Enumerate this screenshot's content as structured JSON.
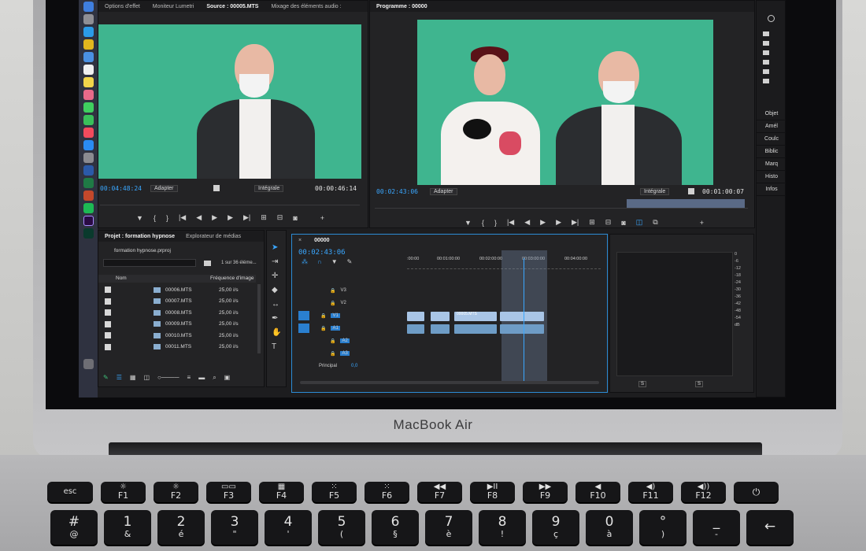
{
  "device": {
    "brand": "MacBook Air"
  },
  "source_monitor": {
    "tabs": [
      "Options d'effet",
      "Moniteur Lumetri",
      "Source : 00005.MTS",
      "Mixage des éléments audio :"
    ],
    "active_tab_index": 2,
    "timecode_in": "00:04:48:24",
    "fit": "Adapter",
    "quality": "Intégrale",
    "timecode_out": "00:00:46:14"
  },
  "program_monitor": {
    "tab": "Programme : 00000",
    "timecode_in": "00:02:43:06",
    "fit": "Adapter",
    "quality": "Intégrale",
    "timecode_out": "00:01:00:07"
  },
  "project_panel": {
    "tabs": [
      "Projet : formation hypnose",
      "Explorateur de médias"
    ],
    "project_file": "formation hypnose.prproj",
    "item_count": "1 sur 36 éléme...",
    "columns": [
      "Nom",
      "Fréquence d'image"
    ],
    "rows": [
      {
        "name": "00006.MTS",
        "fps": "25,00 i/s"
      },
      {
        "name": "00007.MTS",
        "fps": "25,00 i/s"
      },
      {
        "name": "00008.MTS",
        "fps": "25,00 i/s"
      },
      {
        "name": "00009.MTS",
        "fps": "25,00 i/s"
      },
      {
        "name": "00010.MTS",
        "fps": "25,00 i/s"
      },
      {
        "name": "00011.MTS",
        "fps": "25,00 i/s"
      }
    ]
  },
  "timeline": {
    "sequence": "00000",
    "timecode": "00:02:43:06",
    "ruler": [
      ":00:00",
      "00:01:00:00",
      "00:02:00:00",
      "00:03:00:00",
      "00:04:00:00"
    ],
    "video_tracks": [
      "V3",
      "V2",
      "V1"
    ],
    "audio_tracks": [
      "A1",
      "A2",
      "A3"
    ],
    "master_label": "Principal",
    "master_value": "0,0",
    "clip_label": "00005.MTS"
  },
  "audio_meter": {
    "scale": [
      "0",
      "-6",
      "-12",
      "-18",
      "-24",
      "-30",
      "-36",
      "-42",
      "-48",
      "-54",
      "dB"
    ],
    "channels": [
      "S",
      "S"
    ]
  },
  "side_panel": {
    "buttons": [
      "Objet",
      "Amél",
      "Coulc",
      "Biblic",
      "Marq",
      "Histo",
      "Infos"
    ]
  },
  "keyboard": {
    "fn_row": [
      {
        "main": "esc",
        "sub": ""
      },
      {
        "main": "☼",
        "sub": "F1"
      },
      {
        "main": "☼",
        "sub": "F2"
      },
      {
        "main": "▭▭",
        "sub": "F3"
      },
      {
        "main": "▦",
        "sub": "F4"
      },
      {
        "main": "⁙",
        "sub": "F5"
      },
      {
        "main": "⁙",
        "sub": "F6"
      },
      {
        "main": "◀◀",
        "sub": "F7"
      },
      {
        "main": "▶II",
        "sub": "F8"
      },
      {
        "main": "▶▶",
        "sub": "F9"
      },
      {
        "main": "◀",
        "sub": "F10"
      },
      {
        "main": "◀)",
        "sub": "F11"
      },
      {
        "main": "◀))",
        "sub": "F12"
      },
      {
        "main": "⏻",
        "sub": ""
      }
    ],
    "num_row": [
      {
        "main": "#",
        "sub": "@"
      },
      {
        "main": "1",
        "sub": "&"
      },
      {
        "main": "2",
        "sub": "é"
      },
      {
        "main": "3",
        "sub": "\""
      },
      {
        "main": "4",
        "sub": "'"
      },
      {
        "main": "5",
        "sub": "("
      },
      {
        "main": "6",
        "sub": "§"
      },
      {
        "main": "7",
        "sub": "è"
      },
      {
        "main": "8",
        "sub": "!"
      },
      {
        "main": "9",
        "sub": "ç"
      },
      {
        "main": "0",
        "sub": "à"
      },
      {
        "main": "°",
        "sub": ")"
      },
      {
        "main": "_",
        "sub": "-"
      },
      {
        "main": "←",
        "sub": ""
      }
    ]
  }
}
